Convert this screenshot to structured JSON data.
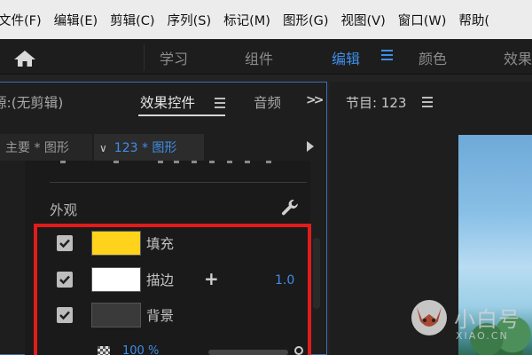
{
  "menu": [
    "文件(F)",
    "编辑(E)",
    "剪辑(C)",
    "序列(S)",
    "标记(M)",
    "图形(G)",
    "视图(V)",
    "窗口(W)",
    "帮助("
  ],
  "workspaces": {
    "items": [
      "学习",
      "组件",
      "编辑",
      "颜色",
      "效果"
    ],
    "active": "编辑"
  },
  "effect_panel": {
    "source_tab": "源:(无剪辑)",
    "active_tab": "效果控件",
    "audio_tab": "音频",
    "master_clip": "主要 * 图形",
    "sequence_clip": "123 * 图形",
    "section_title": "外观"
  },
  "appearance": {
    "fill_label": "填充",
    "fill_color": "#FFD21C",
    "stroke_label": "描边",
    "stroke_color": "#FFFFFF",
    "stroke_width": "1.0",
    "background_label": "背景",
    "background_color": "#3A3A3A",
    "opacity": "100 %"
  },
  "program_monitor": {
    "title": "节目: 123"
  },
  "watermark": {
    "text": "小白号",
    "sub": "XIAO.CN"
  },
  "colors": {
    "accent": "#3E8EE8",
    "highlight_box": "#E21B1B"
  }
}
